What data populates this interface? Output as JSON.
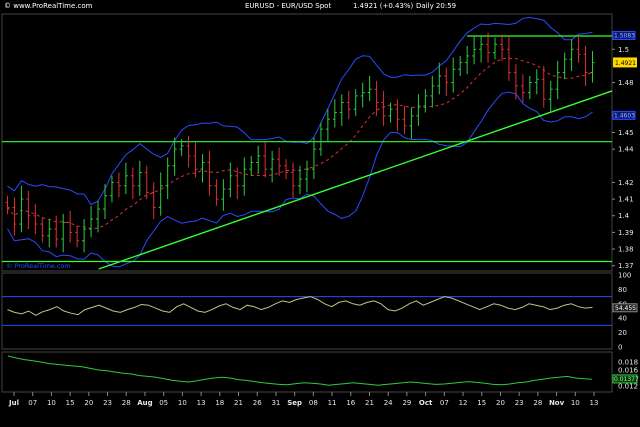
{
  "header": {
    "brand": "© www.ProRealTime.com",
    "instrument": "EURUSD - EUR/USD Spot",
    "price": "1.4921 (+0.43%)",
    "timeframe": "Daily 20:59"
  },
  "watermark": "© ProRealTime.com",
  "colors": {
    "background": "#000000",
    "up_candle": "#2ecc40",
    "down_candle": "#e03030",
    "bollinger": "#2a4bff",
    "moving_average": "#e03030",
    "trendline": "#33ff33",
    "price_tag": "#ffd700"
  },
  "chart_data": [
    {
      "type": "candlestick",
      "panel": "price",
      "series": [
        {
          "name": "EURUSD"
        }
      ],
      "x_tick_labels": [
        "Jul",
        "07",
        "10",
        "15",
        "20",
        "23",
        "28",
        "Aug",
        "05",
        "10",
        "13",
        "18",
        "21",
        "26",
        "31",
        "Sep",
        "08",
        "11",
        "16",
        "21",
        "24",
        "29",
        "Oct",
        "07",
        "12",
        "15",
        "20",
        "23",
        "28",
        "Nov",
        "10",
        "13"
      ],
      "y_tick_labels": [
        "1.5",
        "1.48",
        "1.46",
        "1.45",
        "1.44",
        "1.42",
        "1.41",
        "1.4",
        "1.39",
        "1.38",
        "1.37"
      ],
      "ylim": [
        1.368,
        1.52
      ],
      "last_price_label": "1.4921",
      "band_labels": [
        "1.5083",
        "1.4603"
      ],
      "closes": [
        1.405,
        1.395,
        1.41,
        1.4,
        1.395,
        1.388,
        1.392,
        1.386,
        1.396,
        1.39,
        1.385,
        1.392,
        1.398,
        1.404,
        1.412,
        1.42,
        1.418,
        1.424,
        1.418,
        1.426,
        1.414,
        1.405,
        1.418,
        1.43,
        1.44,
        1.442,
        1.436,
        1.428,
        1.432,
        1.418,
        1.41,
        1.416,
        1.424,
        1.418,
        1.428,
        1.432,
        1.436,
        1.428,
        1.434,
        1.43,
        1.426,
        1.418,
        1.422,
        1.428,
        1.44,
        1.452,
        1.458,
        1.462,
        1.468,
        1.464,
        1.472,
        1.474,
        1.476,
        1.468,
        1.46,
        1.464,
        1.458,
        1.454,
        1.46,
        1.466,
        1.472,
        1.478,
        1.484,
        1.48,
        1.488,
        1.492,
        1.496,
        1.5,
        1.503,
        1.498,
        1.503,
        1.5,
        1.486,
        1.478,
        1.474,
        1.48,
        1.482,
        1.47,
        1.476,
        1.486,
        1.494,
        1.5,
        1.497,
        1.486,
        1.492
      ],
      "bollinger_upper_start": 1.425,
      "bollinger_lower_start": 1.37,
      "trendline_points": [
        [
          0.16,
          1.368
        ],
        [
          1.0,
          1.475
        ]
      ],
      "horizontal_levels": [
        1.4445,
        1.3725,
        1.508
      ]
    },
    {
      "type": "line",
      "panel": "oscillator",
      "y_tick_labels": [
        "100",
        "80",
        "60",
        "54.455",
        "40",
        "20",
        "0"
      ],
      "ylim": [
        0,
        100
      ],
      "last_value_label": "54.455",
      "bands": [
        70,
        30
      ],
      "values": [
        52,
        48,
        46,
        50,
        44,
        49,
        52,
        56,
        50,
        47,
        45,
        52,
        55,
        58,
        54,
        50,
        48,
        52,
        55,
        59,
        58,
        54,
        50,
        48,
        56,
        60,
        55,
        50,
        48,
        52,
        57,
        60,
        55,
        52,
        58,
        56,
        52,
        55,
        60,
        64,
        62,
        66,
        68,
        70,
        66,
        60,
        56,
        62,
        64,
        60,
        58,
        62,
        64,
        60,
        52,
        50,
        54,
        60,
        64,
        58,
        62,
        66,
        70,
        68,
        64,
        60,
        56,
        52,
        56,
        60,
        58,
        54,
        52,
        55,
        60,
        58,
        56,
        52,
        54,
        58,
        60,
        56,
        54,
        55
      ]
    },
    {
      "type": "line",
      "panel": "indicator",
      "y_tick_labels": [
        "0.018",
        "0.016",
        "0.01377",
        "0.012"
      ],
      "ylim": [
        0.011,
        0.02
      ],
      "last_value_label": "0.01377",
      "values": [
        0.0195,
        0.019,
        0.0186,
        0.0183,
        0.018,
        0.0176,
        0.0174,
        0.0172,
        0.017,
        0.0168,
        0.0164,
        0.016,
        0.0158,
        0.0155,
        0.0152,
        0.015,
        0.0146,
        0.0144,
        0.0142,
        0.0138,
        0.0134,
        0.0132,
        0.013,
        0.0133,
        0.0137,
        0.014,
        0.0142,
        0.014,
        0.0136,
        0.0134,
        0.0131,
        0.0128,
        0.0126,
        0.0124,
        0.0123,
        0.0126,
        0.0128,
        0.0127,
        0.0125,
        0.0122,
        0.0124,
        0.0126,
        0.0128,
        0.0126,
        0.0124,
        0.0122,
        0.0124,
        0.0126,
        0.0128,
        0.013,
        0.0128,
        0.0126,
        0.0124,
        0.0125,
        0.0127,
        0.0129,
        0.0131,
        0.0129,
        0.0127,
        0.0124,
        0.0123,
        0.0125,
        0.0128,
        0.013,
        0.0134,
        0.0137,
        0.014,
        0.0142,
        0.0144,
        0.014,
        0.0138,
        0.0137
      ]
    }
  ]
}
